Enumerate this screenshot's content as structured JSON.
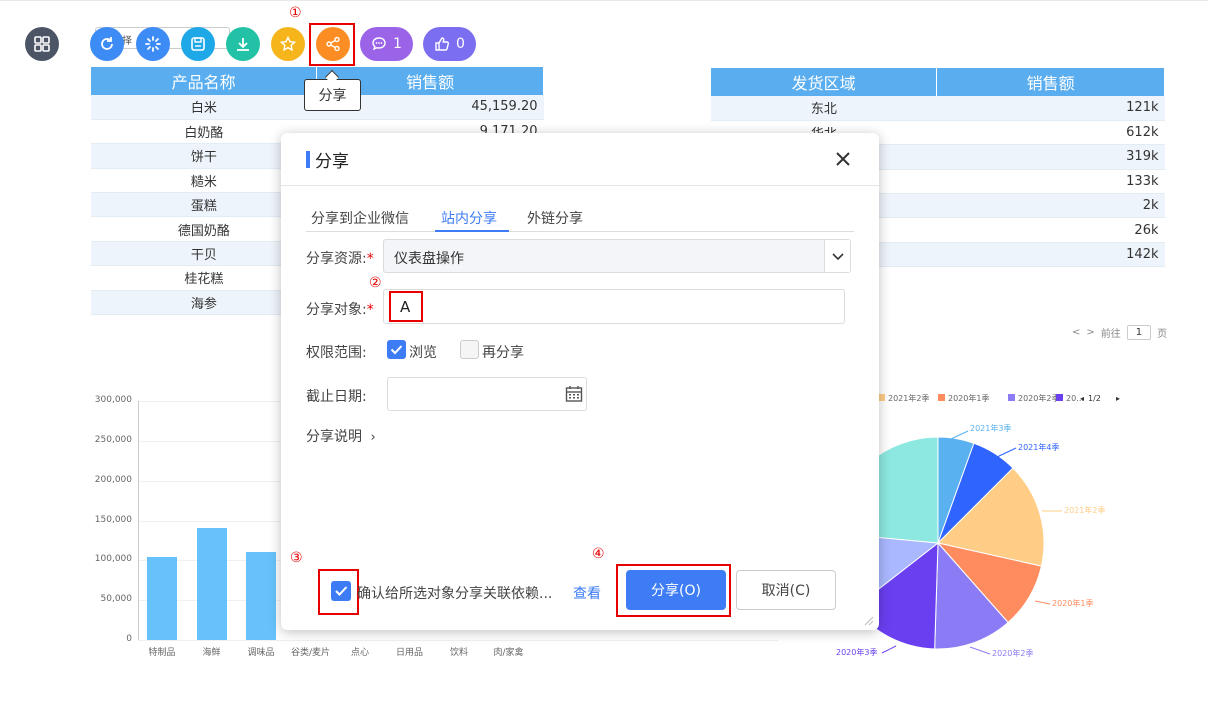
{
  "toolbar": {
    "select_placeholder": "择",
    "comment_count": "1",
    "like_count": "0",
    "tooltip_share": "分享"
  },
  "annotations": [
    "①",
    "②",
    "③",
    "④"
  ],
  "left_table": {
    "headers": [
      "产品名称",
      "销售额"
    ],
    "rows": [
      [
        "白米",
        "45,159.20"
      ],
      [
        "白奶酪",
        "9,171.20"
      ],
      [
        "饼干",
        ""
      ],
      [
        "糙米",
        ""
      ],
      [
        "蛋糕",
        ""
      ],
      [
        "德国奶酪",
        ""
      ],
      [
        "干贝",
        ""
      ],
      [
        "桂花糕",
        ""
      ],
      [
        "海参",
        ""
      ]
    ]
  },
  "right_table": {
    "headers": [
      "发货区域",
      "销售额"
    ],
    "rows": [
      [
        "东北",
        "121k"
      ],
      [
        "华北",
        "612k"
      ],
      [
        "",
        "319k"
      ],
      [
        "",
        "133k"
      ],
      [
        "",
        "2k"
      ],
      [
        "",
        "26k"
      ],
      [
        "",
        "142k"
      ]
    ]
  },
  "pagination": {
    "prev": "<",
    "next": ">",
    "goto": "前往",
    "page": "1",
    "unit": "页"
  },
  "chart_data": [
    {
      "type": "bar",
      "categories": [
        "特制品",
        "海鲜",
        "调味品",
        "谷类/麦片",
        "点心",
        "日用品",
        "饮料",
        "肉/家禽"
      ],
      "values": [
        104000,
        141000,
        111000,
        null,
        null,
        null,
        null,
        null
      ],
      "ylim": [
        0,
        300000
      ],
      "yticks": [
        "300,000",
        "250,000",
        "200,000",
        "150,000",
        "100,000",
        "50,000",
        "0"
      ]
    },
    {
      "type": "pie",
      "legend": [
        "2021年2季",
        "2020年1季",
        "2020年2季",
        "20…"
      ],
      "legend_page": "1/2",
      "labels": [
        "2021年3季",
        "2021年4季",
        "2021年2季",
        "2020年1季",
        "2020年2季",
        "2020年3季"
      ],
      "colors": [
        "#5ab1ef",
        "#2f64ff",
        "#ffcd86",
        "#ff8c5f",
        "#8b7cf6",
        "#6a3ff0",
        "#a9b8ff",
        "#8ce8e0"
      ]
    }
  ],
  "dialog": {
    "title": "分享",
    "tabs": [
      "分享到企业微信",
      "站内分享",
      "外链分享"
    ],
    "active_tab": 1,
    "resource_label": "分享资源:",
    "resource_value": "仪表盘操作",
    "target_label": "分享对象:",
    "target_value": "A",
    "perm_label": "权限范围:",
    "perm_browse": "浏览",
    "perm_reshare": "再分享",
    "deadline_label": "截止日期:",
    "desc_label": "分享说明",
    "confirm_text": "确认给所选对象分享关联依赖...",
    "view_link": "查看",
    "share_btn": "分享(O)",
    "cancel_btn": "取消(C)"
  }
}
